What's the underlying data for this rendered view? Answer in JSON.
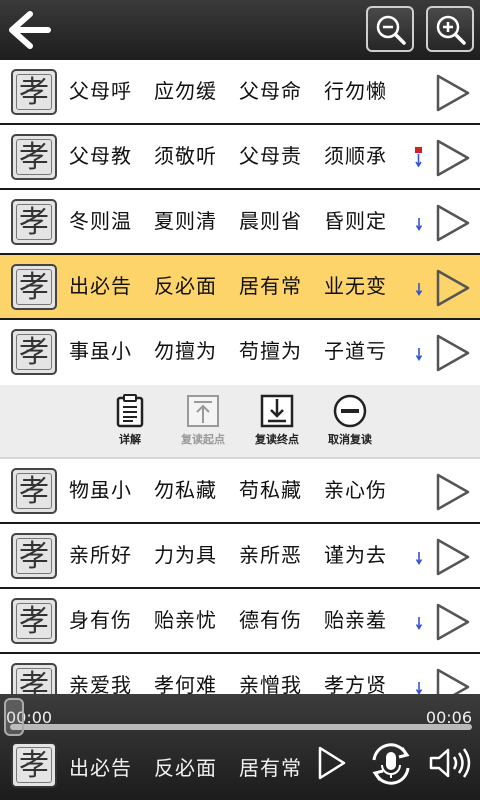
{
  "header": {
    "back_icon": "arrow-left-icon",
    "zoom_out_icon": "zoom-out-icon",
    "zoom_in_icon": "zoom-in-icon"
  },
  "seal_char": "孝",
  "rows": [
    {
      "phrases": [
        "父母呼",
        "应勿缓",
        "父母命",
        "行勿懒"
      ],
      "mark": "none",
      "active": false
    },
    {
      "phrases": [
        "父母教",
        "须敬听",
        "父母责",
        "须顺承"
      ],
      "mark": "red-start",
      "active": false
    },
    {
      "phrases": [
        "冬则温",
        "夏则清",
        "晨则省",
        "昏则定"
      ],
      "mark": "down",
      "active": false
    },
    {
      "phrases": [
        "出必告",
        "反必面",
        "居有常",
        "业无变"
      ],
      "mark": "down",
      "active": true
    },
    {
      "phrases": [
        "事虽小",
        "勿擅为",
        "苟擅为",
        "子道亏"
      ],
      "mark": "down",
      "active": false
    }
  ],
  "actions": [
    {
      "label": "详解",
      "icon": "clipboard-icon",
      "enabled": true
    },
    {
      "label": "复读起点",
      "icon": "upload-arrow-icon",
      "enabled": false
    },
    {
      "label": "复读终点",
      "icon": "download-arrow-icon",
      "enabled": true
    },
    {
      "label": "取消复读",
      "icon": "minus-circle-icon",
      "enabled": true
    }
  ],
  "rows_after": [
    {
      "phrases": [
        "物虽小",
        "勿私藏",
        "苟私藏",
        "亲心伤"
      ],
      "mark": "none",
      "active": false
    },
    {
      "phrases": [
        "亲所好",
        "力为具",
        "亲所恶",
        "谨为去"
      ],
      "mark": "down",
      "active": false
    },
    {
      "phrases": [
        "身有伤",
        "贻亲忧",
        "德有伤",
        "贻亲羞"
      ],
      "mark": "down",
      "active": false
    },
    {
      "phrases": [
        "亲爱我",
        "孝何难",
        "亲憎我",
        "孝方贤"
      ],
      "mark": "down",
      "active": false
    }
  ],
  "player": {
    "time_start": "00:00",
    "time_end": "00:06",
    "progress": 0,
    "phrases": [
      "出必告",
      "反必面",
      "居有常"
    ],
    "play_icon": "play-icon",
    "repeat_icon": "repeat-mic-icon",
    "volume_icon": "speaker-icon"
  },
  "colors": {
    "active_row": "#fdd469",
    "marker_blue": "#3355cc",
    "marker_red": "#d42020"
  }
}
